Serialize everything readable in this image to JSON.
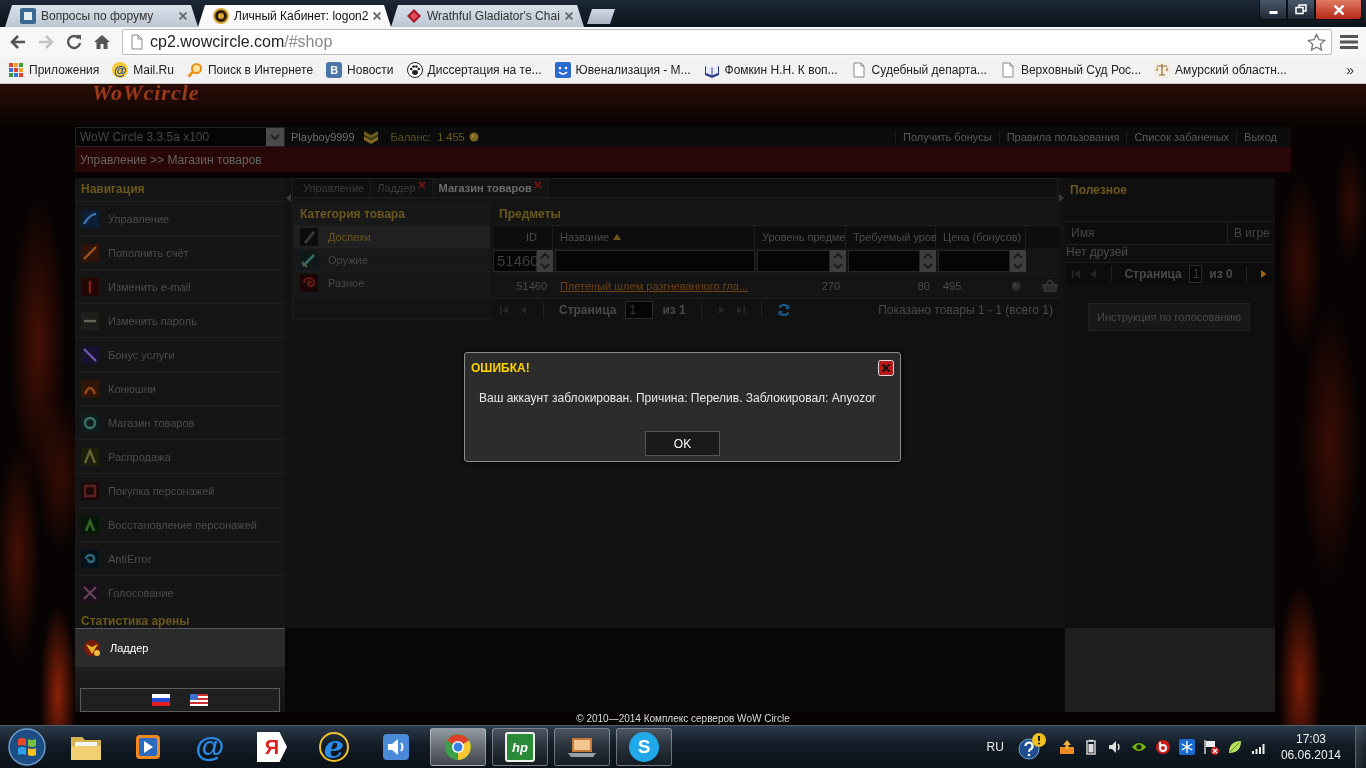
{
  "browser": {
    "tabs": [
      {
        "title": "Вопросы по форуму",
        "kind": "forum",
        "selected": false
      },
      {
        "title": "Личный Кабинет: logon2",
        "kind": "game",
        "selected": true
      },
      {
        "title": "Wrathful Gladiator's Chai",
        "kind": "item",
        "selected": false
      }
    ],
    "back_disabled": false,
    "forward_disabled": true,
    "address": {
      "host": "cp2.wowcircle.com",
      "path": "/#shop"
    },
    "bookmarks": [
      {
        "label": "Приложения",
        "kind": "apps"
      },
      {
        "label": "Mail.Ru",
        "kind": "mail",
        "glyph": "@"
      },
      {
        "label": "Поиск в Интернете",
        "kind": "search"
      },
      {
        "label": "Новости",
        "kind": "vk",
        "glyph": "В"
      },
      {
        "label": "Диссертация на те...",
        "kind": "paw"
      },
      {
        "label": "Ювенализация - М...",
        "kind": "smile"
      },
      {
        "label": "Фомкин Н.Н. К воп...",
        "kind": "book"
      },
      {
        "label": "Судебный департа...",
        "kind": "page"
      },
      {
        "label": "Верховный Суд Рос...",
        "kind": "page"
      },
      {
        "label": "Амурский областн...",
        "kind": "scales"
      }
    ],
    "more": "»"
  },
  "page": {
    "logo": "WoWcircle",
    "realm": "WoW Circle 3.3.5a x100",
    "user": "Playboy9999",
    "balance_label": "Баланс:",
    "balance": "1 455",
    "links": [
      "Получить бонусы",
      "Правила пользования",
      "Список забаненых",
      "Выход"
    ],
    "breadcrumb": "Управление >> Магазин товаров",
    "nav": {
      "title": "Навигация",
      "items": [
        "Управление",
        "Пополнить счёт",
        "Изменить e-mail",
        "Изменить пароль",
        "Бонус услуги",
        "Конюшни",
        "Магазин товаров",
        "Распродажа",
        "Покупка персонажей",
        "Восстановление персонажей",
        "AntiError",
        "Голосование"
      ]
    },
    "arena": {
      "title": "Статистика арены",
      "items": [
        "Ладдер"
      ]
    },
    "tabs": [
      {
        "label": "Управление",
        "closable": false,
        "selected": false
      },
      {
        "label": "Ладдер",
        "closable": true,
        "selected": false
      },
      {
        "label": "Магазин товаров",
        "closable": true,
        "selected": true
      }
    ],
    "categories": {
      "title": "Категория товара",
      "items": [
        {
          "label": "Доспехи",
          "kind": "armor",
          "selected": true
        },
        {
          "label": "Оружие",
          "kind": "weapon",
          "selected": false
        },
        {
          "label": "Разное",
          "kind": "misc",
          "selected": false
        }
      ]
    },
    "items": {
      "title": "Предметы",
      "columns": [
        {
          "label": "ID"
        },
        {
          "label": "Название",
          "sorted": true,
          "ascending": true
        },
        {
          "label": "Уровень предме"
        },
        {
          "label": "Требуемый уров"
        },
        {
          "label": "Цена (бонусов)"
        }
      ],
      "filters": [
        {
          "kind": "number",
          "value": "51460"
        },
        {
          "kind": "text"
        },
        {
          "kind": "number"
        },
        {
          "kind": "number"
        },
        {
          "kind": "number"
        }
      ],
      "rows": [
        {
          "id": "51460",
          "name": "Плетеный шлем разгневанного гла...",
          "item_level": "270",
          "required_level": "80",
          "price": "495"
        }
      ],
      "pager": {
        "label": "Страница",
        "page": "1",
        "total": "из 1",
        "prev_disabled": true,
        "next_disabled": true,
        "summary": "Показано товары 1 - 1 (всего 1)"
      }
    },
    "useful": {
      "title": "Полезное",
      "columns": [
        "Имя",
        "В игре"
      ],
      "empty": "Нет друзей",
      "pager": {
        "label": "Страница",
        "page": "1",
        "total": "из 0",
        "prev_disabled": true,
        "next_disabled": false
      },
      "button": "Инструкция по голосованию"
    },
    "footer": "© 2010—2014 Комплекс серверов WoW Circle"
  },
  "dialog": {
    "title": "ОШИБКА!",
    "message": "Ваш аккаунт заблокирован. Причина: Перелив. Заблокировал: Anyozor",
    "button": "OK"
  },
  "taskbar": {
    "apps": [
      {
        "kind": "explorer",
        "running": false,
        "selected": false
      },
      {
        "kind": "media",
        "running": false,
        "selected": false
      },
      {
        "kind": "mail",
        "glyph": "@",
        "running": false,
        "selected": false
      },
      {
        "kind": "yandex",
        "glyph": "Я",
        "running": false,
        "selected": false
      },
      {
        "kind": "ie",
        "glyph": "e",
        "running": false,
        "selected": false
      },
      {
        "kind": "sound",
        "running": false,
        "selected": false
      },
      {
        "kind": "chrome",
        "running": true,
        "selected": true
      },
      {
        "kind": "hp",
        "glyph": "hp",
        "running": true,
        "selected": false
      },
      {
        "kind": "laptop",
        "running": true,
        "selected": false
      },
      {
        "kind": "skype",
        "glyph": "S",
        "running": true,
        "selected": false
      }
    ],
    "language": "RU",
    "time": "17:03",
    "date": "06.06.2014"
  }
}
